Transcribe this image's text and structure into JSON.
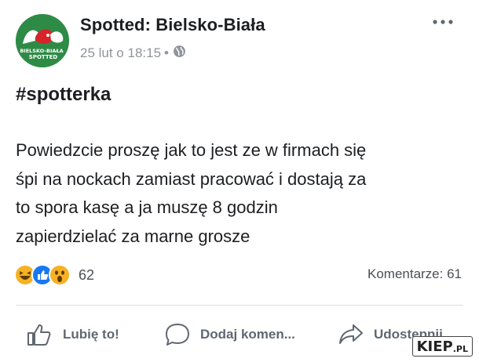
{
  "post": {
    "page_name": "Spotted: Bielsko-Biała",
    "timestamp": "25 lut o 18:15",
    "separator": "•",
    "privacy_icon": "globe-icon",
    "more_icon": "ellipsis-icon",
    "avatar": {
      "text_line1": "BIELSKO-BIAŁA",
      "text_line2": "SPOTTED"
    },
    "hashtag": "#spotterka",
    "text_lines": [
      "Powiedzcie proszę jak to jest ze w firmach się",
      "śpi na nockach zamiast pracować i dostają za",
      "to spora kasę a ja muszę 8 godzin",
      "zapierdzielać za marne grosze"
    ]
  },
  "stats": {
    "reaction_icons": [
      "haha-icon",
      "like-icon",
      "wow-icon"
    ],
    "reactions_count": "62",
    "comments": "Komentarze: 61"
  },
  "actions": {
    "like": {
      "label": "Lubię to!",
      "icon": "thumbs-up-icon"
    },
    "comment": {
      "label": "Dodaj komen...",
      "icon": "comment-bubble-icon"
    },
    "share": {
      "label": "Udostępnij",
      "icon": "share-arrow-icon"
    }
  },
  "watermark": {
    "main": "KIEP",
    "suffix": ".PL"
  },
  "colors": {
    "text": "#1c1e21",
    "meta": "#90949c",
    "action": "#606770",
    "like_blue": "#1877f2",
    "reaction_yellow": "#f7b125",
    "avatar_green": "#2e8b46"
  }
}
